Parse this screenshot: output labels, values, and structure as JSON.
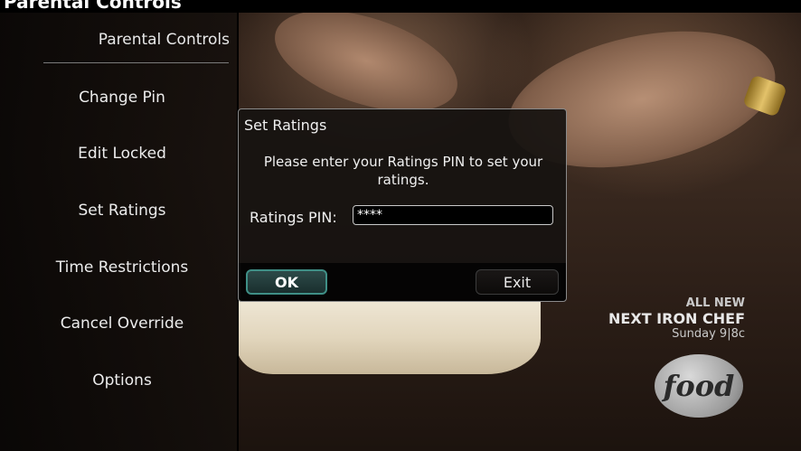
{
  "window_title": "Parental Controls",
  "sidebar": {
    "title": "Parental Controls",
    "items": [
      {
        "label": "Change Pin"
      },
      {
        "label": "Edit Locked"
      },
      {
        "label": "Set Ratings"
      },
      {
        "label": "Time Restrictions"
      },
      {
        "label": "Cancel Override"
      },
      {
        "label": "Options"
      }
    ]
  },
  "dialog": {
    "title": "Set Ratings",
    "message": "Please enter your Ratings PIN to set your ratings.",
    "pin_label": "Ratings PIN:",
    "pin_value": "****",
    "ok_label": "OK",
    "exit_label": "Exit"
  },
  "promo": {
    "line1": "ALL NEW",
    "line2": "NEXT IRON CHEF",
    "line3": "Sunday 9|8c",
    "logo_text": "food"
  },
  "colors": {
    "ok_border": "#3f8f86",
    "dialog_border": "#8a8a8a"
  },
  "icons": [
    "food-network-logo"
  ]
}
